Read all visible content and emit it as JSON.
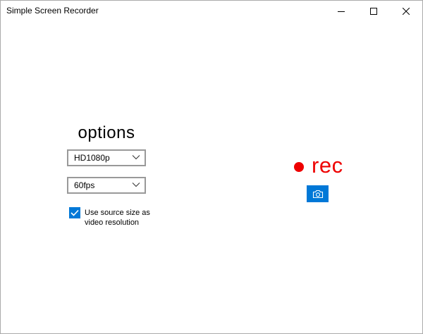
{
  "window": {
    "title": "Simple Screen Recorder"
  },
  "options": {
    "heading": "options",
    "resolution": {
      "selected": "HD1080p"
    },
    "framerate": {
      "selected": "60fps"
    },
    "use_source_size": {
      "checked": true,
      "label_line1": "Use source size as",
      "label_line2": "video resolution"
    }
  },
  "recorder": {
    "rec_label": "rec",
    "icons": {
      "record": "record-dot-icon",
      "screenshot": "camera-icon"
    }
  },
  "colors": {
    "accent": "#0078d7",
    "record_red": "#ee0000",
    "combo_border": "#999999"
  }
}
